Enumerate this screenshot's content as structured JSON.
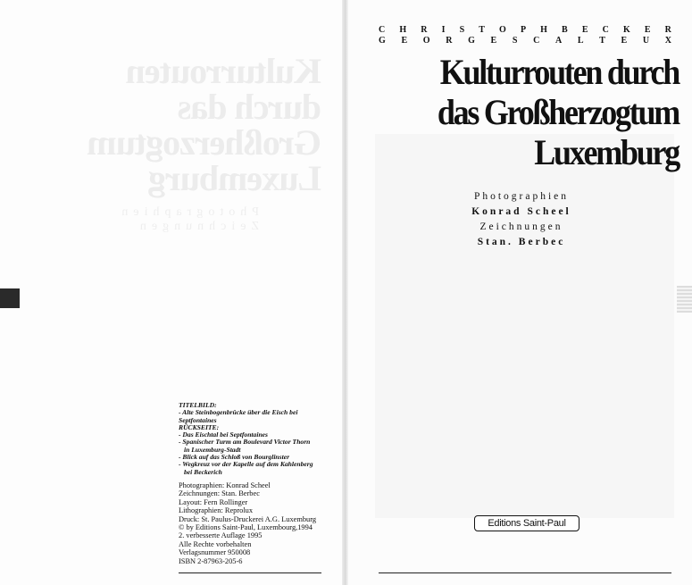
{
  "left_page": {
    "credits": {
      "titelbild_heading": "TITELBILD:",
      "titelbild_item": "- Alte Steinbogenbrücke über die Eisch bei Septfontaines",
      "rueckseite_heading": "RÜCKSEITE:",
      "items": [
        "- Das Eischtal bei Septfontaines",
        "- Spanischer Turm am Boulevard Victor Thorn",
        "in Luxemburg-Stadt",
        "- Blick auf das Schloß von Bourglinster",
        "- Wegkreuz vor der Kapelle auf dem Kahlenberg",
        "bei Beckerich"
      ]
    },
    "imprint": [
      "Photographien: Konrad Scheel",
      "Zeichnungen: Stan. Berbec",
      "Layout: Fern Rollinger",
      "Lithographien: Reprolux",
      "Druck: St. Paulus-Druckerei A.G. Luxemburg",
      "© by Editions Saint-Paul, Luxembourg,1994",
      "2. verbesserte Auflage 1995",
      "Alle Rechte vorbehalten",
      "Verlagsnummer 950008",
      "ISBN 2-87963-205-6"
    ]
  },
  "right_page": {
    "authors": [
      {
        "first": [
          "C",
          "H",
          "R",
          "I",
          "S",
          "T",
          "O",
          "P",
          "H"
        ],
        "last": [
          "B",
          "E",
          "C",
          "K",
          "E",
          "R"
        ]
      },
      {
        "first": [
          "G",
          "E",
          "O",
          "R",
          "G",
          "E",
          "S"
        ],
        "last": [
          "C",
          "A",
          "L",
          "T",
          "E",
          "U",
          "X"
        ]
      }
    ],
    "title_lines": [
      "Kulturrouten durch",
      "das Großherzogtum",
      "Luxemburg"
    ],
    "contributors": [
      {
        "text": "Photographien",
        "bold": false
      },
      {
        "text": "Konrad Scheel",
        "bold": true
      },
      {
        "text": "Zeichnungen",
        "bold": false
      },
      {
        "text": "Stan. Berbec",
        "bold": true
      }
    ],
    "publisher": "Editions Saint-Paul"
  }
}
